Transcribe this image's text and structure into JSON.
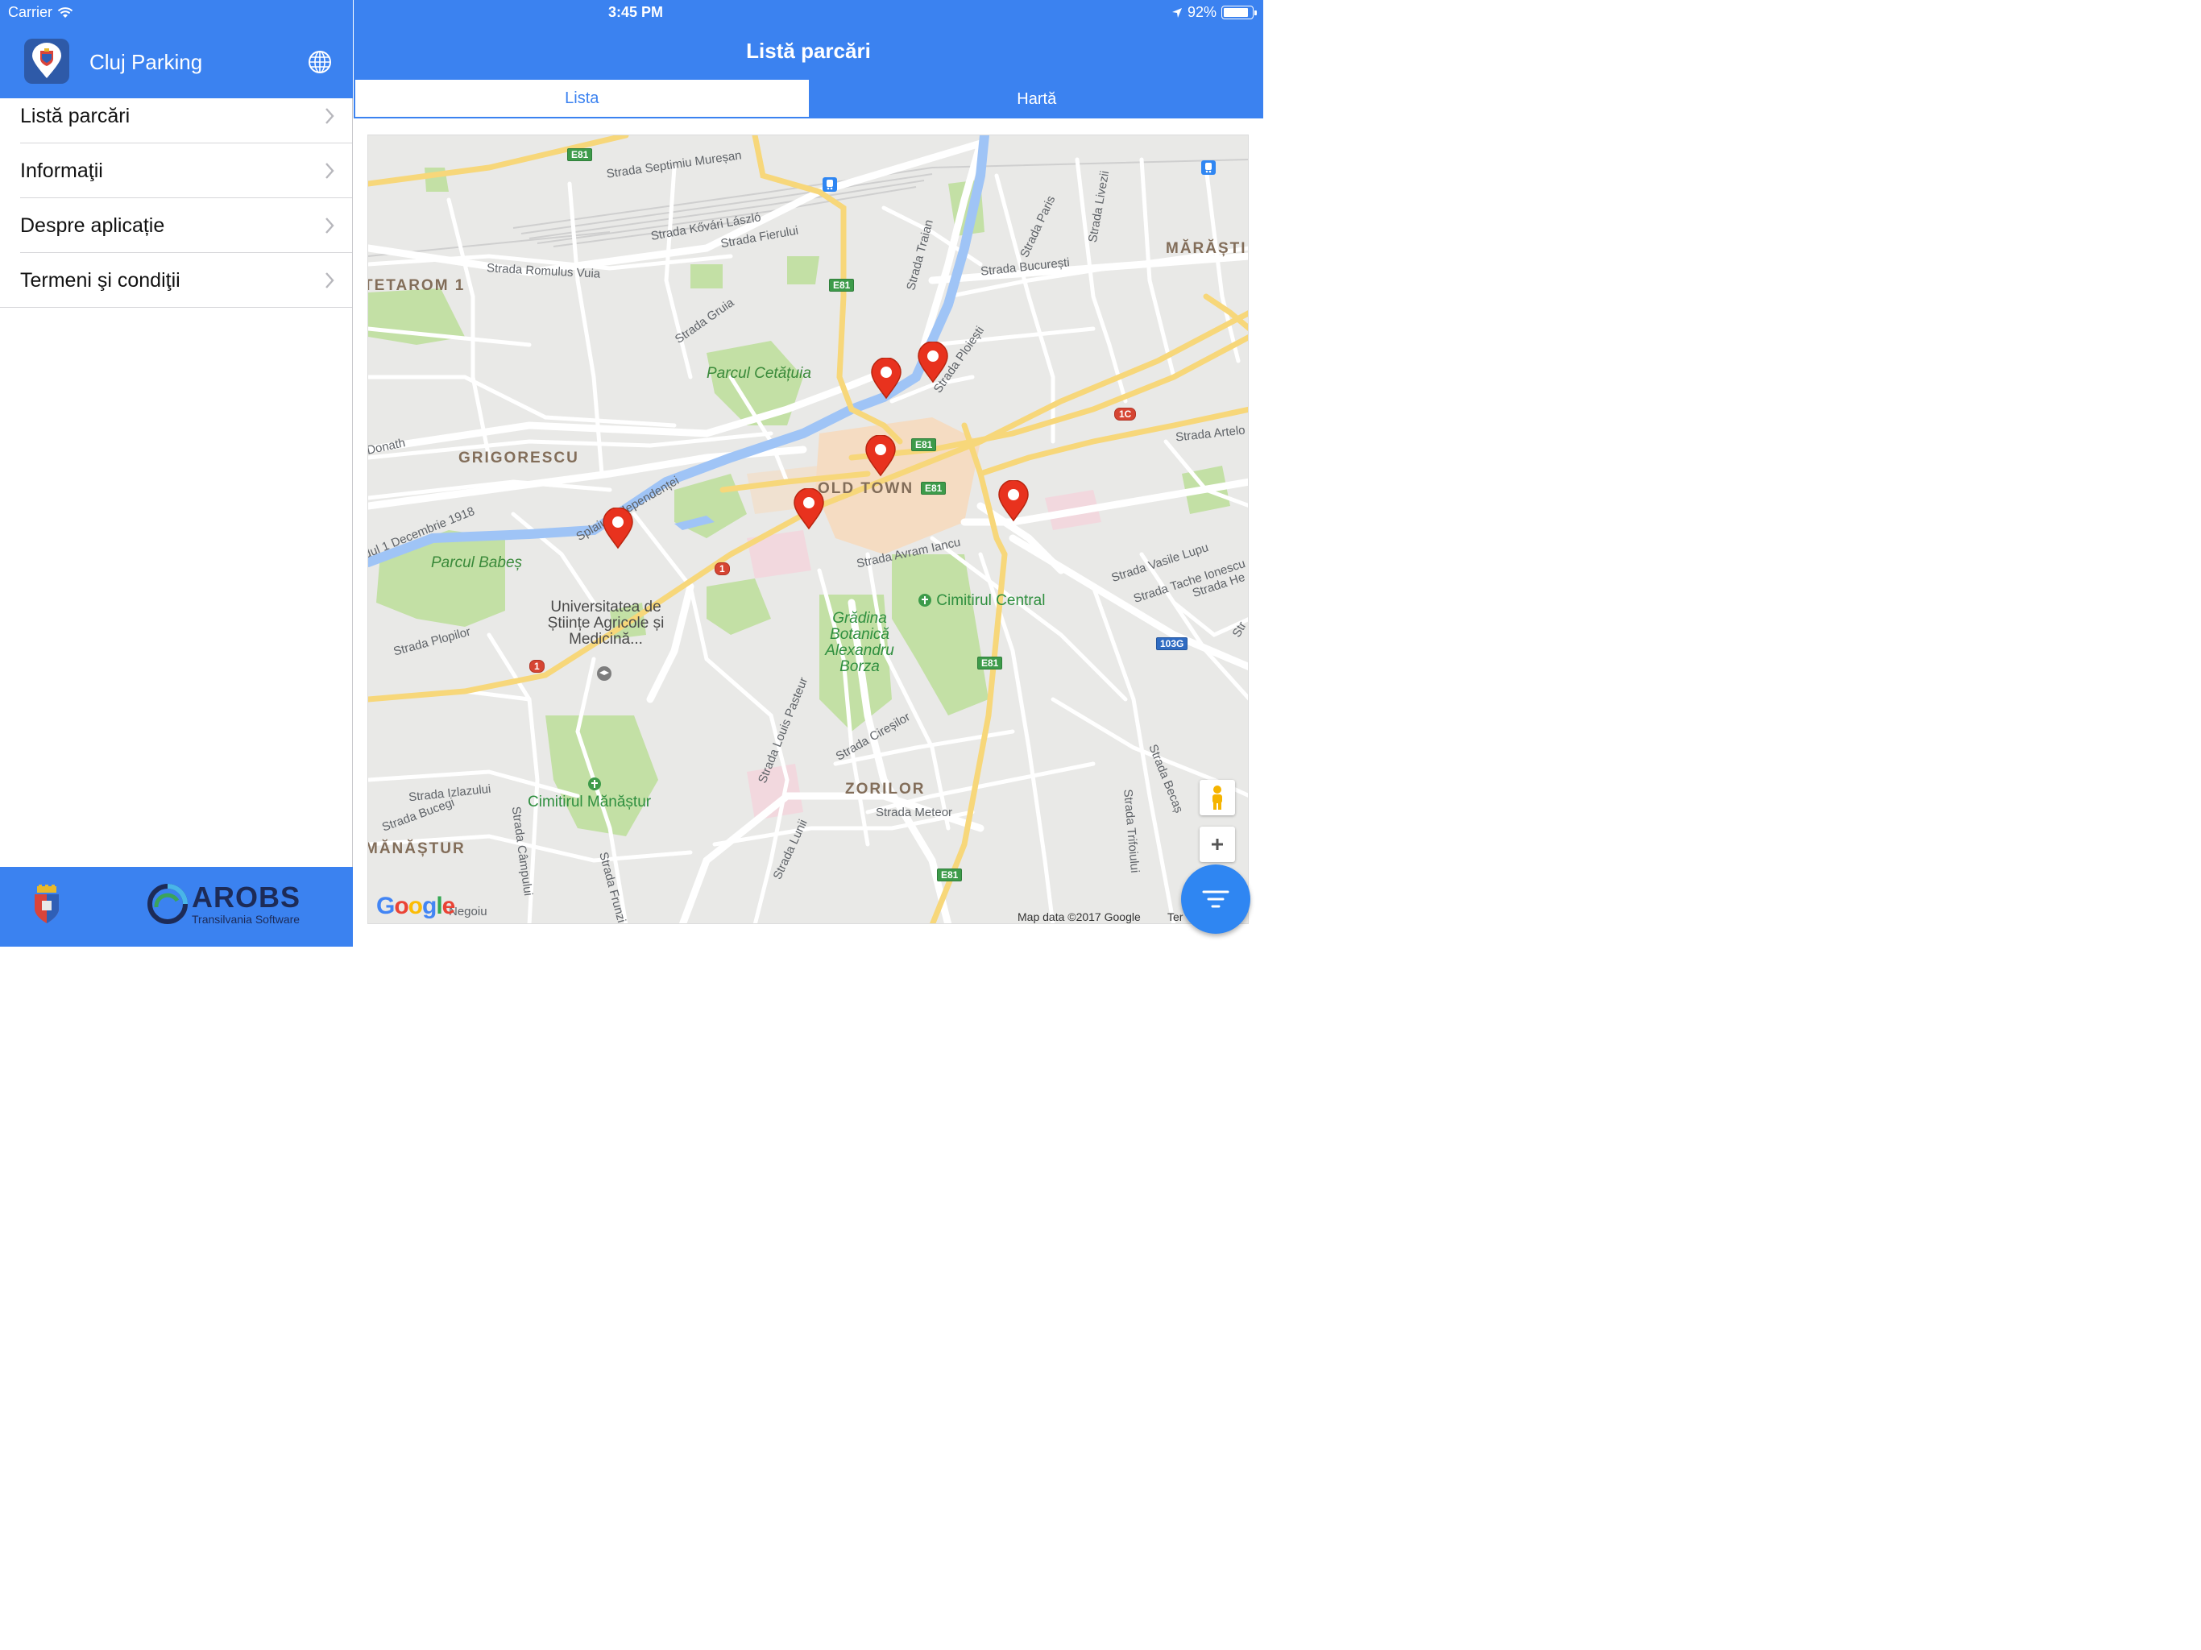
{
  "status_bar": {
    "carrier": "Carrier",
    "time": "3:45 PM",
    "battery_text": "92%",
    "battery_level": 0.92
  },
  "sidebar": {
    "app_title": "Cluj Parking",
    "items": [
      {
        "label": "Listă parcări"
      },
      {
        "label": "Informaţii"
      },
      {
        "label": "Despre aplicație"
      },
      {
        "label": "Termeni şi condiţii"
      }
    ],
    "footer": {
      "brand": "AROBS",
      "brand_sub": "Transilvania Software"
    }
  },
  "main": {
    "title": "Listă parcări",
    "tabs": [
      {
        "label": "Lista",
        "active": true
      },
      {
        "label": "Hartă",
        "active": false
      }
    ]
  },
  "map": {
    "street_labels": [
      "Strada Septimiu Mureșan",
      "Strada Kővári László",
      "Strada Fierului",
      "Strada Romulus Vuia",
      "Strada Grui­a",
      "Strada Traian",
      "Strada Paris",
      "Strada Livezii",
      "Strada București",
      "Strada Ploiești",
      "Strada Artelo",
      "Donath",
      "Splaiul Independenței",
      "dul 1 Decembrie 1918",
      "Strada Avram Iancu",
      "Strada Vasile Lupu",
      "Strada Tache Ionescu",
      "Strada He",
      "Strada Plopilor",
      "Strada Louis Pasteur",
      "Strada Cireșilor",
      "Strada Izlazului",
      "Strada Bucegi",
      "Strada Câmpului",
      "Strada Meteor",
      "Strada Lunii",
      "Strada Frunzi",
      "Negoiu",
      "Strada Becaș",
      "Strada Trifoiului",
      "Str"
    ],
    "districts": [
      "MĂRĂȘTI",
      "TETAROM 1",
      "GRIGORESCU",
      "OLD TOWN",
      "ZORILOR",
      "MĂNĂȘTUR"
    ],
    "parks": [
      "Parcul Cetățuia",
      "Parcul Babeș",
      "Cimitirul Central",
      "Cimitirul Mănăștur"
    ],
    "places": {
      "university": "Universitatea de Științe Agricole și Medicină...",
      "botanical": "Grădina Botanică Alexandru Borza"
    },
    "shields": [
      "E81",
      "E81",
      "E81",
      "E81",
      "E81",
      "E81",
      "E81",
      "1C",
      "1",
      "1",
      "103G"
    ],
    "attribution": "Map data ©2017 Google",
    "terms": "Ter",
    "google": "Google",
    "colors": {
      "accent": "#3b82f0",
      "pin": "#e8321e",
      "park": "#c3e0a5",
      "water": "#9fc4f6",
      "highway": "#f7d77a"
    }
  }
}
